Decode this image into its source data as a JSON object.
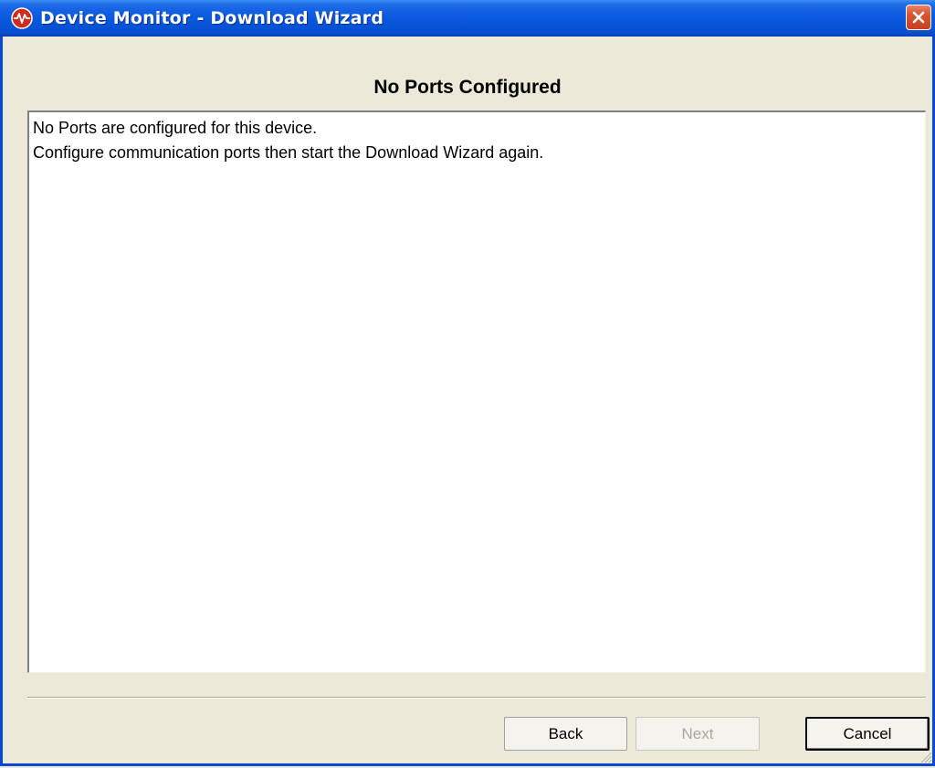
{
  "window": {
    "title": "Device Monitor - Download Wizard",
    "app_icon": "pulse-icon",
    "close_icon": "close-icon"
  },
  "wizard": {
    "page_title": "No Ports Configured",
    "message_lines": [
      "No Ports are configured for this device.",
      "Configure communication ports then start the Download Wizard again."
    ]
  },
  "buttons": {
    "back": "Back",
    "next": "Next",
    "cancel": "Cancel"
  },
  "colors": {
    "titlebar": "#0a5ae0",
    "close_button": "#d9542f",
    "dialog_background": "#ece9d8",
    "disabled_text": "#aca899"
  }
}
